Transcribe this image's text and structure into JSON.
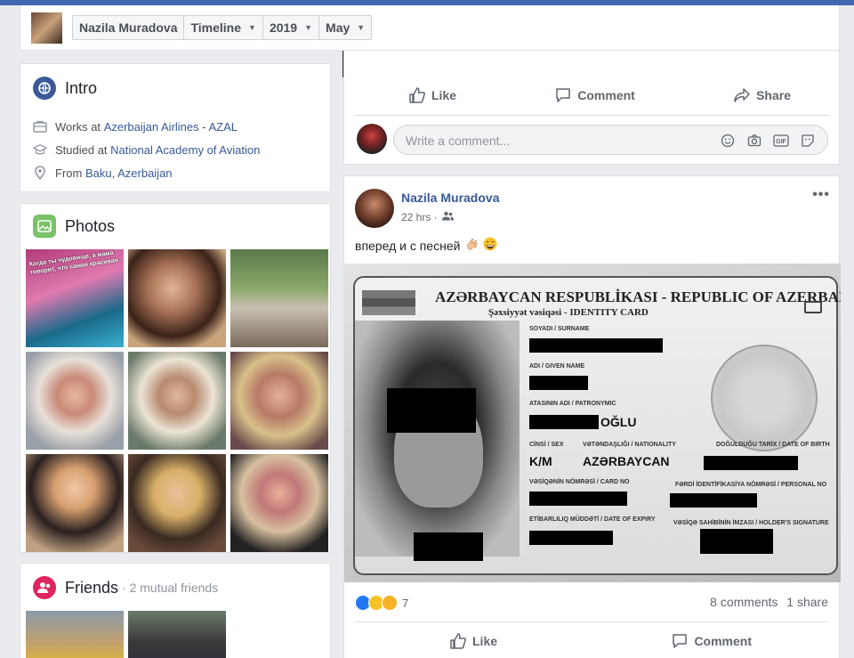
{
  "header": {
    "profile_name": "Nazila Muradova",
    "nav_timeline": "Timeline",
    "nav_year": "2019",
    "nav_month": "May"
  },
  "intro": {
    "title": "Intro",
    "works_prefix": "Works at ",
    "works_link": "Azerbaijan Airlines - AZAL",
    "studied_prefix": "Studied at ",
    "studied_link": "National Academy of Aviation",
    "from_prefix": "From ",
    "from_link": "Baku, Azerbaijan"
  },
  "photos": {
    "title": "Photos",
    "first_photo_caption": "Когда ты чудовище, а мама говорит, что самая красивая"
  },
  "friends": {
    "title": "Friends",
    "mutual": "· 2 mutual friends"
  },
  "post1": {
    "like_label": "Like",
    "comment_label": "Comment",
    "share_label": "Share",
    "comment_placeholder": "Write a comment..."
  },
  "post2": {
    "author": "Nazila Muradova",
    "time": "22 hrs ·",
    "text": "вперед и с песней",
    "reaction_count": "7",
    "comments_count": "8 comments",
    "shares_count": "1 share",
    "like_label": "Like",
    "comment_label": "Comment"
  },
  "id_card": {
    "title": "AZƏRBAYCAN RESPUBLİKASI - REPUBLIC OF AZERBAIJAN",
    "subtitle": "Şəxsiyyət vəsiqəsi - IDENTITY CARD",
    "surname_label": "SOYADI / SURNAME",
    "given_name_label": "ADI / GIVEN NAME",
    "patronymic_label": "ATASININ ADI / PATRONYMIC",
    "patronymic_suffix": "OĞLU",
    "sex_label": "CİNSİ / SEX",
    "sex_value": "K/M",
    "nationality_label": "VƏTƏNDAŞLIĞI / NATIONALITY",
    "nationality_value": "AZƏRBAYCAN",
    "dob_label": "DOĞULDUĞU TARİX / DATE OF BIRTH",
    "card_no_label": "VƏSİQƏNİN NÖMRƏSİ / CARD NO",
    "personal_no_label": "FƏRDİ İDENTİFİKASİYA NÖMRƏSİ / PERSONAL NO",
    "expiry_label": "ETİBARLILIQ MÜDDƏTİ / DATE OF EXPIRY",
    "signature_label": "VƏSİQƏ SAHİBİNİN İMZASI / HOLDER'S SIGNATURE"
  },
  "colors": {
    "fb_blue": "#4267b2",
    "link": "#385898",
    "intro_icon": "#3b5998",
    "photos_icon": "#7bc26a",
    "friends_icon": "#e0245e"
  }
}
